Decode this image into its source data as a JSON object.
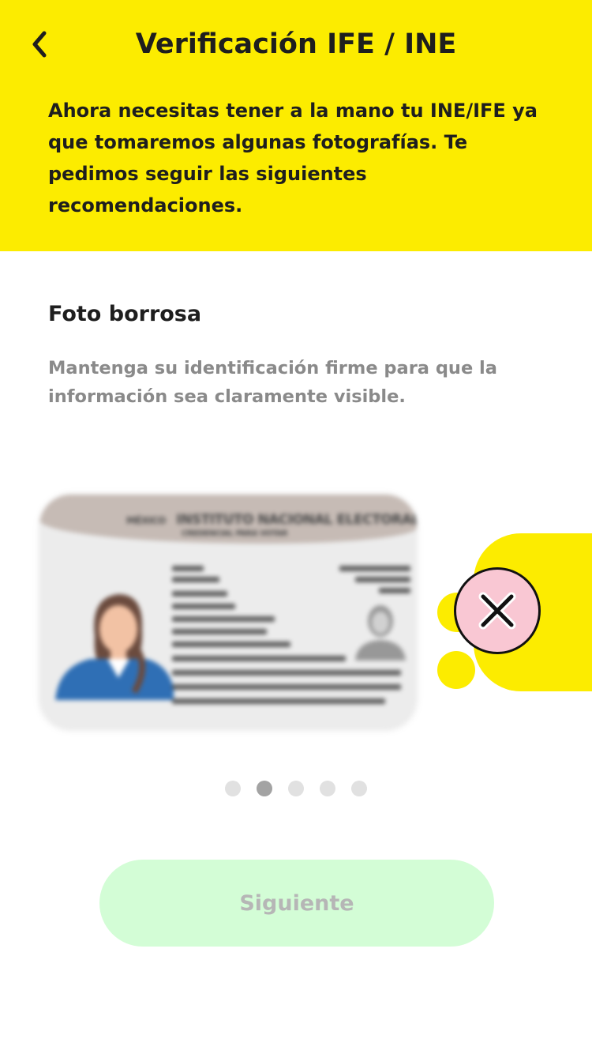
{
  "header": {
    "title": "Verificación IFE / INE",
    "back_icon": "chevron-left-icon",
    "intro": "Ahora necesitas tener a la mano tu INE/IFE ya que tomaremos algunas fotografías. Te pedimos seguir las siguientes recomendaciones."
  },
  "slide": {
    "title": "Foto borrosa",
    "description": "Mantenga su identificación firme para que la información sea claramente visible.",
    "card": {
      "country": "MÉXICO",
      "institution": "INSTITUTO NACIONAL ELECTORAL",
      "subtitle": "CREDENCIAL PARA VOTAR"
    },
    "status_icon": "x-circle-icon"
  },
  "pagination": {
    "total": 5,
    "active_index": 1
  },
  "footer": {
    "next_label": "Siguiente"
  },
  "colors": {
    "header_bg": "#FCEC00",
    "button_bg": "#D3FDD6",
    "button_text": "#B6B6B6",
    "badge_bg": "#F9C7D3",
    "title_text": "#1E1E1E",
    "desc_text": "#8A8A8A"
  }
}
